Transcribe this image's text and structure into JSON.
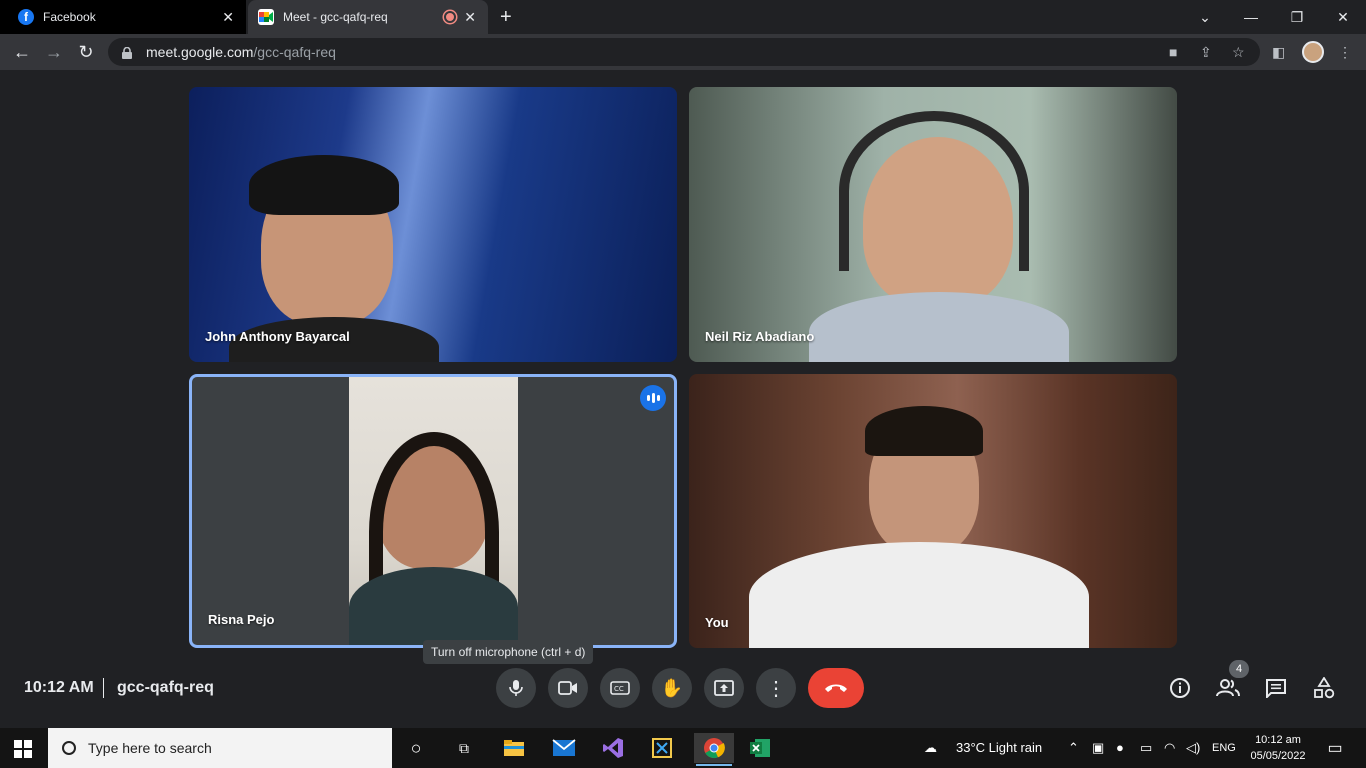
{
  "browser": {
    "tabs": [
      {
        "title": "Facebook",
        "favicon": "facebook-icon",
        "active": false
      },
      {
        "title": "Meet - gcc-qafq-req",
        "favicon": "google-meet-icon",
        "active": true,
        "recording": true
      }
    ],
    "url_host": "meet.google.com",
    "url_path": "/gcc-qafq-req"
  },
  "meeting": {
    "participants": [
      {
        "name": "John Anthony Bayarcal"
      },
      {
        "name": "Neil Riz Abadiano"
      },
      {
        "name": "Risna Pejo",
        "speaking": true
      },
      {
        "name": "You"
      }
    ],
    "tooltip": "Turn off microphone (ctrl + d)",
    "time": "10:12 AM",
    "code": "gcc-qafq-req",
    "participant_count": "4"
  },
  "taskbar": {
    "search_placeholder": "Type here to search",
    "weather": "33°C  Light rain",
    "language": "ENG",
    "time": "10:12 am",
    "date": "05/05/2022"
  },
  "colors": {
    "accent": "#8ab4f8",
    "hangup": "#ea4335",
    "speaking": "#1a73e8"
  }
}
